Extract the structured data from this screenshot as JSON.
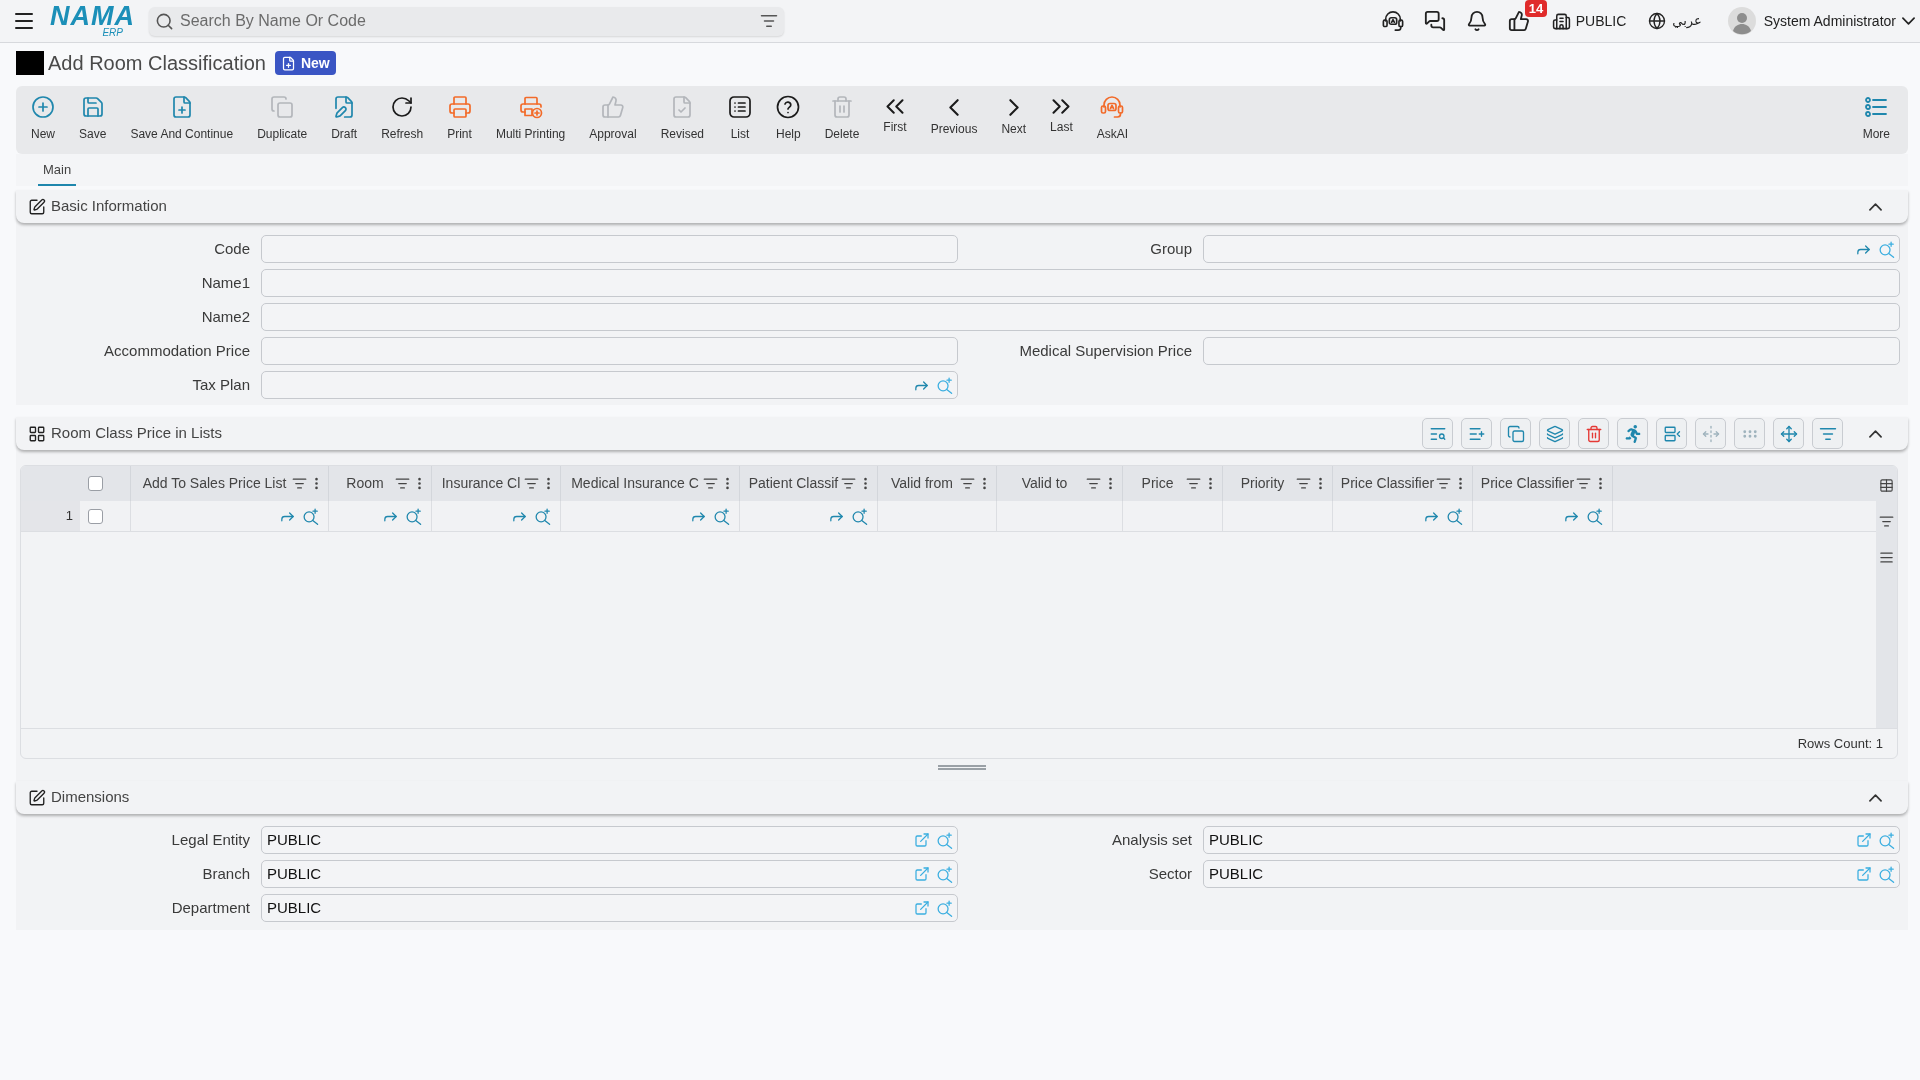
{
  "app_bar": {
    "logo": {
      "name": "NAMA",
      "suffix": "ERP"
    },
    "search": {
      "placeholder": "Search By Name Or Code"
    },
    "badge_count": "14",
    "company": "PUBLIC",
    "language": "عربي",
    "user": "System Administrator"
  },
  "page": {
    "title": "Add Room Classification",
    "status": "New"
  },
  "toolbar": [
    {
      "label": "New",
      "kind": "new",
      "disabled": false
    },
    {
      "label": "Save",
      "kind": "save",
      "disabled": false
    },
    {
      "label": "Save And Continue",
      "kind": "save_continue",
      "disabled": false
    },
    {
      "label": "Duplicate",
      "kind": "duplicate",
      "disabled": true
    },
    {
      "label": "Draft",
      "kind": "draft",
      "disabled": false
    },
    {
      "label": "Refresh",
      "kind": "refresh",
      "disabled": false
    },
    {
      "label": "Print",
      "kind": "print",
      "disabled": false
    },
    {
      "label": "Multi Printing",
      "kind": "multi_print",
      "disabled": false
    },
    {
      "label": "Approval",
      "kind": "approval",
      "disabled": true
    },
    {
      "label": "Revised",
      "kind": "revised",
      "disabled": true
    },
    {
      "label": "List",
      "kind": "list",
      "disabled": false
    },
    {
      "label": "Help",
      "kind": "help",
      "disabled": false
    },
    {
      "label": "Delete",
      "kind": "delete",
      "disabled": true
    },
    {
      "label": "First",
      "kind": "first",
      "disabled": false
    },
    {
      "label": "Previous",
      "kind": "previous",
      "disabled": false
    },
    {
      "label": "Next",
      "kind": "next",
      "disabled": false
    },
    {
      "label": "Last",
      "kind": "last",
      "disabled": false
    },
    {
      "label": "AskAI",
      "kind": "ask_ai",
      "disabled": false
    }
  ],
  "more": {
    "label": "More"
  },
  "tabs": [
    {
      "label": "Main",
      "selected": true
    }
  ],
  "basic_information": {
    "title": "Basic Information",
    "expanded": true,
    "fields": [
      {
        "label": "Code",
        "kind": "text"
      },
      {
        "label": "Group",
        "kind": "lookup"
      },
      {
        "label": "Name1",
        "kind": "wide"
      },
      {
        "label": "Name2",
        "kind": "wide"
      },
      {
        "label": "Accommodation Price",
        "kind": "text"
      },
      {
        "label": "Medical Supervision Price",
        "kind": "text"
      },
      {
        "label": "Tax Plan",
        "kind": "lookup"
      }
    ]
  },
  "price_lists": {
    "title": "Room Class Price in Lists",
    "expanded": true,
    "tools": [
      {
        "kind": "find",
        "disabled": false
      },
      {
        "kind": "add_row",
        "disabled": false
      },
      {
        "kind": "copy",
        "disabled": false
      },
      {
        "kind": "layers",
        "disabled": false
      },
      {
        "kind": "delete",
        "disabled": false
      },
      {
        "kind": "run",
        "disabled": false
      },
      {
        "kind": "insert",
        "disabled": false
      },
      {
        "kind": "fit",
        "disabled": true
      },
      {
        "kind": "grip",
        "disabled": true
      },
      {
        "kind": "move",
        "disabled": false
      },
      {
        "kind": "filter",
        "disabled": false
      }
    ],
    "select_all": {
      "checked": false
    },
    "columns": [
      {
        "label": "Add To Sales Price List",
        "kind": "lookup"
      },
      {
        "label": "Room",
        "kind": "lookup"
      },
      {
        "label": "Insurance Cl",
        "kind": "lookup"
      },
      {
        "label": "Medical Insurance C",
        "kind": "lookup"
      },
      {
        "label": "Patient Classif",
        "kind": "lookup"
      },
      {
        "label": "Valid from",
        "kind": "text"
      },
      {
        "label": "Valid to",
        "kind": "text"
      },
      {
        "label": "Price",
        "kind": "text"
      },
      {
        "label": "Priority",
        "kind": "text"
      },
      {
        "label": "Price Classifier",
        "kind": "lookup"
      },
      {
        "label": "Price Classifier",
        "kind": "lookup"
      }
    ],
    "rows": [
      {
        "number": "1",
        "selected": false
      }
    ],
    "rows_count": "Rows Count: 1"
  },
  "dimensions": {
    "title": "Dimensions",
    "expanded": true,
    "fields": [
      {
        "label": "Legal Entity",
        "kind": "link_lookup",
        "value": "PUBLIC"
      },
      {
        "label": "Analysis set",
        "kind": "link_lookup",
        "value": "PUBLIC"
      },
      {
        "label": "Branch",
        "kind": "link_lookup",
        "value": "PUBLIC"
      },
      {
        "label": "Sector",
        "kind": "link_lookup",
        "value": "PUBLIC"
      },
      {
        "label": "Department",
        "kind": "link_lookup",
        "value": "PUBLIC"
      }
    ]
  }
}
